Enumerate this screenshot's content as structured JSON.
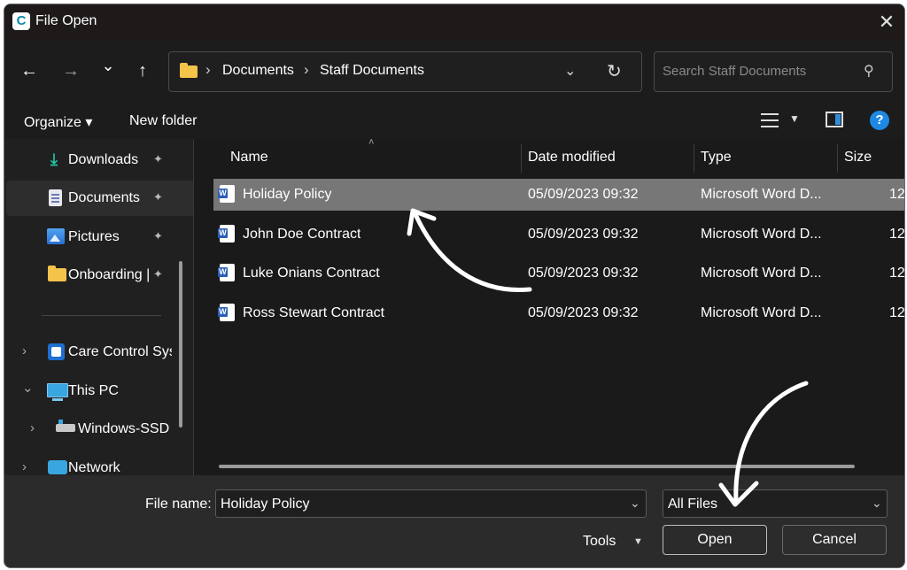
{
  "window": {
    "title": "File Open",
    "close_glyph": "✕"
  },
  "nav": {
    "back_glyph": "←",
    "forward_glyph": "→",
    "recent_glyph": "⌄",
    "up_glyph": "↑"
  },
  "address": {
    "breadcrumbs": [
      "Documents",
      "Staff Documents"
    ],
    "separator": "›",
    "dropdown_glyph": "⌄",
    "refresh_glyph": "↻"
  },
  "search": {
    "placeholder": "Search Staff Documents",
    "icon_glyph": "⚲"
  },
  "toolbar": {
    "organize_label": "Organize ▾",
    "new_folder_label": "New folder",
    "help_label": "?"
  },
  "sidebar": {
    "items": [
      {
        "label": "Downloads",
        "icon": "download-icon",
        "pinned": true
      },
      {
        "label": "Documents",
        "icon": "documents-icon",
        "pinned": true
      },
      {
        "label": "Pictures",
        "icon": "pictures-icon",
        "pinned": true
      },
      {
        "label": "Onboarding |",
        "icon": "folder-icon",
        "pinned": true
      },
      {
        "label": "Care Control Sys",
        "icon": "care-control-icon",
        "expandable": true
      },
      {
        "label": "This PC",
        "icon": "pc-icon",
        "expanded": true
      },
      {
        "label": "Windows-SSD",
        "icon": "drive-icon",
        "expandable": true
      },
      {
        "label": "Network",
        "icon": "network-icon",
        "expandable": true
      }
    ],
    "pin_glyph": "📌",
    "chevron_right": "›",
    "chevron_down": "⌄"
  },
  "files": {
    "columns": [
      "Name",
      "Date modified",
      "Type",
      "Size"
    ],
    "sort_glyph": "˄",
    "rows": [
      {
        "name": "Holiday Policy",
        "date": "05/09/2023 09:32",
        "type": "Microsoft Word D...",
        "size": "12",
        "selected": true
      },
      {
        "name": "John Doe Contract",
        "date": "05/09/2023 09:32",
        "type": "Microsoft Word D...",
        "size": "12"
      },
      {
        "name": "Luke Onians Contract",
        "date": "05/09/2023 09:32",
        "type": "Microsoft Word D...",
        "size": "12"
      },
      {
        "name": "Ross Stewart Contract",
        "date": "05/09/2023 09:32",
        "type": "Microsoft Word D...",
        "size": "12"
      }
    ]
  },
  "footer": {
    "file_name_label": "File name:",
    "file_name_value": "Holiday Policy",
    "file_type_value": "All Files",
    "tools_label": "Tools",
    "open_label": "Open",
    "cancel_label": "Cancel",
    "dropdown_glyph": "⌄"
  },
  "colors": {
    "background": "#202020",
    "selected_row": "#777777",
    "accent": "#1e88e5",
    "annotation_arrow": "#ffffff"
  }
}
